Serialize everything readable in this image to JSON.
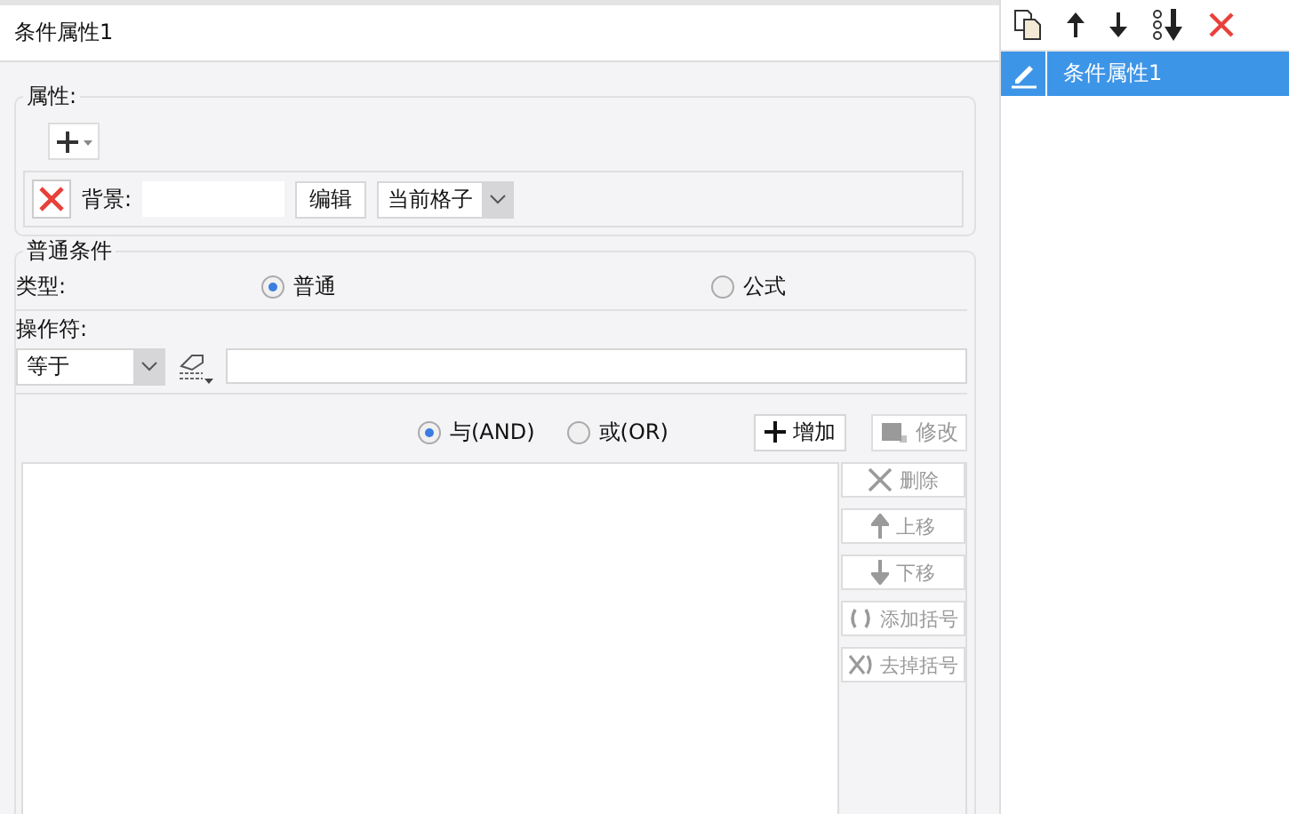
{
  "title": "条件属性1",
  "attributes": {
    "legend": "属性:",
    "rows": [
      {
        "label": "背景:",
        "edit_button": "编辑",
        "scope": "当前格子"
      }
    ]
  },
  "condition": {
    "legend": "普通条件",
    "type_label": "类型:",
    "types": [
      {
        "label": "普通",
        "selected": true
      },
      {
        "label": "公式",
        "selected": false
      }
    ],
    "operator_label": "操作符:",
    "operator": "等于",
    "logic": [
      {
        "label": "与(AND)",
        "selected": true
      },
      {
        "label": "或(OR)",
        "selected": false
      }
    ],
    "add_button": {
      "label": "增加",
      "disabled": false
    },
    "modify_button": {
      "label": "修改",
      "disabled": true
    },
    "side_buttons": [
      {
        "kind": "delete",
        "label": "删除",
        "disabled": true
      },
      {
        "kind": "up",
        "label": "上移",
        "disabled": true
      },
      {
        "kind": "down",
        "label": "下移",
        "disabled": true
      },
      {
        "kind": "add-brackets",
        "label": "添加括号",
        "disabled": true
      },
      {
        "kind": "remove-brackets",
        "label": "去掉括号",
        "disabled": true
      }
    ]
  },
  "conditions": [
    {
      "name": "条件属性1",
      "selected": true
    }
  ]
}
